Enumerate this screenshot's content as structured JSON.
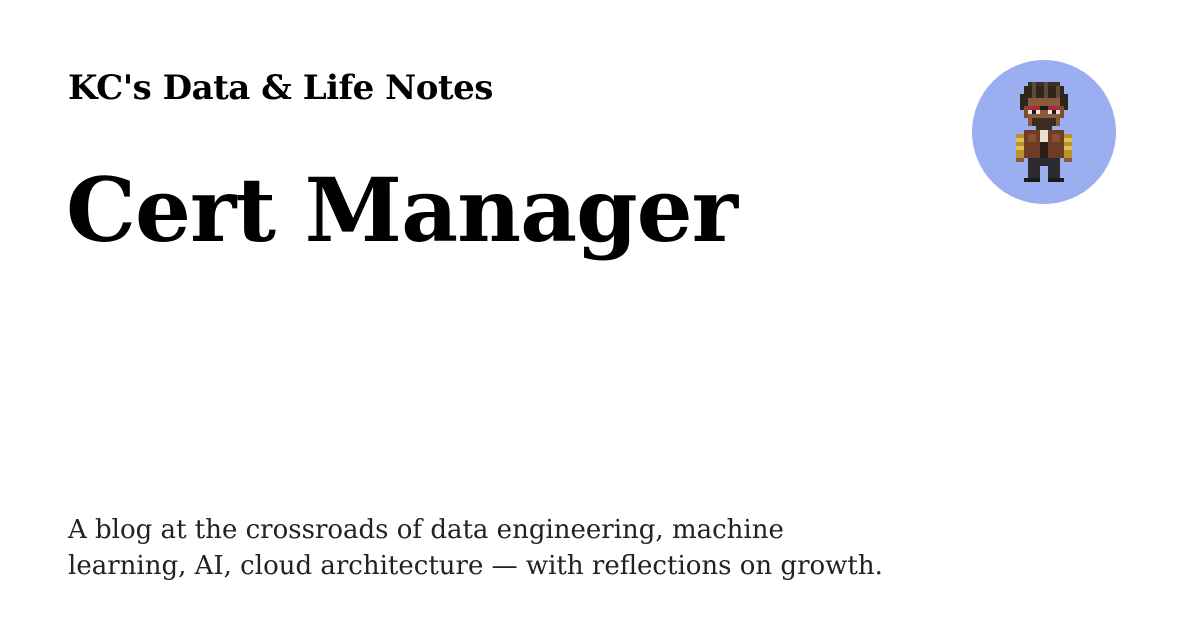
{
  "card": {
    "site_name": "KC's Data & Life Notes",
    "title": "Cert Manager",
    "description": "A blog at the crossroads of data engineering, machine learning, AI, cloud architecture — with reflections on growth."
  },
  "avatar": {
    "icon": "pixel-art-character-icon",
    "background_color": "#9aaef0"
  }
}
